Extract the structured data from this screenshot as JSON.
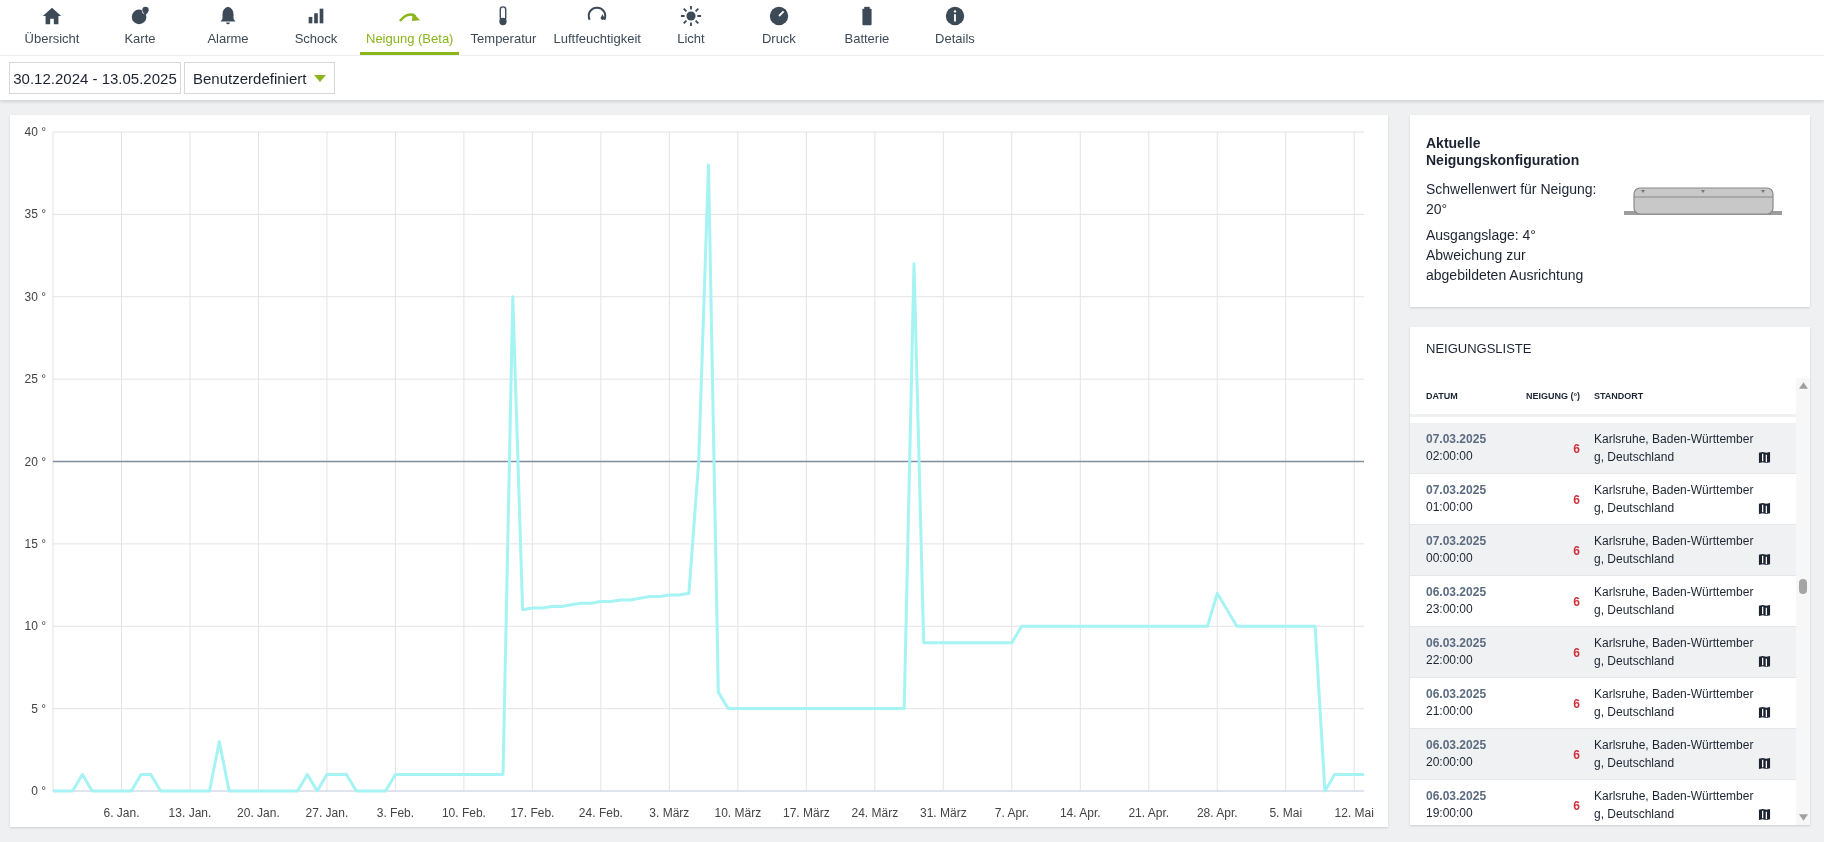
{
  "tabs": [
    {
      "label": "Übersicht",
      "selected": false
    },
    {
      "label": "Karte",
      "selected": false
    },
    {
      "label": "Alarme",
      "selected": false
    },
    {
      "label": "Schock",
      "selected": false
    },
    {
      "label": "Neigung (Beta)",
      "selected": true
    },
    {
      "label": "Temperatur",
      "selected": false
    },
    {
      "label": "Luftfeuchtigkeit",
      "selected": false
    },
    {
      "label": "Licht",
      "selected": false
    },
    {
      "label": "Druck",
      "selected": false
    },
    {
      "label": "Batterie",
      "selected": false
    },
    {
      "label": "Details",
      "selected": false
    }
  ],
  "filter": {
    "date_range": "30.12.2024 - 13.05.2025",
    "period": "Benutzerdefiniert"
  },
  "chart_data": {
    "type": "line",
    "categories": [
      null,
      null,
      null,
      null,
      null,
      null,
      null,
      "6. Jan.",
      null,
      null,
      null,
      null,
      null,
      null,
      "13. Jan.",
      null,
      null,
      null,
      null,
      null,
      null,
      "20. Jan.",
      null,
      null,
      null,
      null,
      null,
      null,
      "27. Jan.",
      null,
      null,
      null,
      null,
      null,
      null,
      "3. Feb.",
      null,
      null,
      null,
      null,
      null,
      null,
      "10. Feb.",
      null,
      null,
      null,
      null,
      null,
      null,
      "17. Feb.",
      null,
      null,
      null,
      null,
      null,
      null,
      "24. Feb.",
      null,
      null,
      null,
      null,
      null,
      null,
      "3. März",
      null,
      null,
      null,
      null,
      null,
      null,
      "10. März",
      null,
      null,
      null,
      null,
      null,
      null,
      "17. März",
      null,
      null,
      null,
      null,
      null,
      null,
      "24. März",
      null,
      null,
      null,
      null,
      null,
      null,
      "31. März",
      null,
      null,
      null,
      null,
      null,
      null,
      "7. Apr.",
      null,
      null,
      null,
      null,
      null,
      null,
      "14. Apr.",
      null,
      null,
      null,
      null,
      null,
      null,
      "21. Apr.",
      null,
      null,
      null,
      null,
      null,
      null,
      "28. Apr.",
      null,
      null,
      null,
      null,
      null,
      null,
      "5. Mai",
      null,
      null,
      null,
      null,
      null,
      null,
      "12. Mai",
      null
    ],
    "series": [
      {
        "color": "#a6f3f3",
        "values": [
          0,
          0,
          0,
          1,
          0,
          0,
          0,
          0,
          0,
          1,
          1,
          0,
          0,
          0,
          0,
          0,
          0,
          3,
          0,
          0,
          0,
          0,
          0,
          0,
          0,
          0,
          1,
          0,
          1,
          1,
          1,
          0,
          0,
          0,
          0,
          1,
          1,
          1,
          1,
          1,
          1,
          1,
          1,
          1,
          1,
          1,
          1,
          30,
          11,
          11.1,
          11.1,
          11.2,
          11.2,
          11.3,
          11.4,
          11.4,
          11.5,
          11.5,
          11.6,
          11.6,
          11.7,
          11.8,
          11.8,
          11.9,
          11.9,
          12,
          20,
          38,
          6,
          5,
          5,
          5,
          5,
          5,
          5,
          5,
          5,
          5,
          5,
          5,
          5,
          5,
          5,
          5,
          5,
          5,
          5,
          5,
          32,
          9,
          9,
          9,
          9,
          9,
          9,
          9,
          9,
          9,
          9,
          10,
          10,
          10,
          10,
          10,
          10,
          10,
          10,
          10,
          10,
          10,
          10,
          10,
          10,
          10,
          10,
          10,
          10,
          10,
          10,
          12,
          11,
          10,
          10,
          10,
          10,
          10,
          10,
          10,
          10,
          10,
          0,
          1,
          1,
          1,
          1
        ]
      }
    ],
    "ylim": [
      0,
      40
    ],
    "yticks": [
      {
        "value": 0,
        "label": "0 °"
      },
      {
        "value": 5,
        "label": "5 °"
      },
      {
        "value": 10,
        "label": "10 °"
      },
      {
        "value": 15,
        "label": "15 °"
      },
      {
        "value": 20,
        "label": "20 °"
      },
      {
        "value": 25,
        "label": "25 °"
      },
      {
        "value": 30,
        "label": "30 °"
      },
      {
        "value": 35,
        "label": "35 °"
      },
      {
        "value": 40,
        "label": "40 °"
      }
    ],
    "grid": true,
    "ref_lines": [
      {
        "axis": "y",
        "value": 20,
        "color": "#7f8e9c"
      }
    ]
  },
  "config": {
    "title": "Aktuelle Neigungskonfiguration",
    "threshold_label": "Schwellenwert für Neigung:",
    "threshold_value": "20°",
    "baseline": "Ausgangslage: 4°",
    "baseline_note": "Abweichung zur abgebildeten Ausrichtung"
  },
  "list": {
    "title": "NEIGUNGSLISTE",
    "columns": [
      "DATUM",
      "NEIGUNG (°)",
      "STANDORT"
    ],
    "rows": [
      {
        "date": "07.03.2025",
        "time": "02:00:00",
        "tilt": "6",
        "location": "Karlsruhe, Baden-Württemberg, Deutschland"
      },
      {
        "date": "07.03.2025",
        "time": "01:00:00",
        "tilt": "6",
        "location": "Karlsruhe, Baden-Württemberg, Deutschland"
      },
      {
        "date": "07.03.2025",
        "time": "00:00:00",
        "tilt": "6",
        "location": "Karlsruhe, Baden-Württemberg, Deutschland"
      },
      {
        "date": "06.03.2025",
        "time": "23:00:00",
        "tilt": "6",
        "location": "Karlsruhe, Baden-Württemberg, Deutschland"
      },
      {
        "date": "06.03.2025",
        "time": "22:00:00",
        "tilt": "6",
        "location": "Karlsruhe, Baden-Württemberg, Deutschland"
      },
      {
        "date": "06.03.2025",
        "time": "21:00:00",
        "tilt": "6",
        "location": "Karlsruhe, Baden-Württemberg, Deutschland"
      },
      {
        "date": "06.03.2025",
        "time": "20:00:00",
        "tilt": "6",
        "location": "Karlsruhe, Baden-Württemberg, Deutschland"
      },
      {
        "date": "06.03.2025",
        "time": "19:00:00",
        "tilt": "6",
        "location": "Karlsruhe, Baden-Württemberg, Deutschland"
      }
    ]
  }
}
